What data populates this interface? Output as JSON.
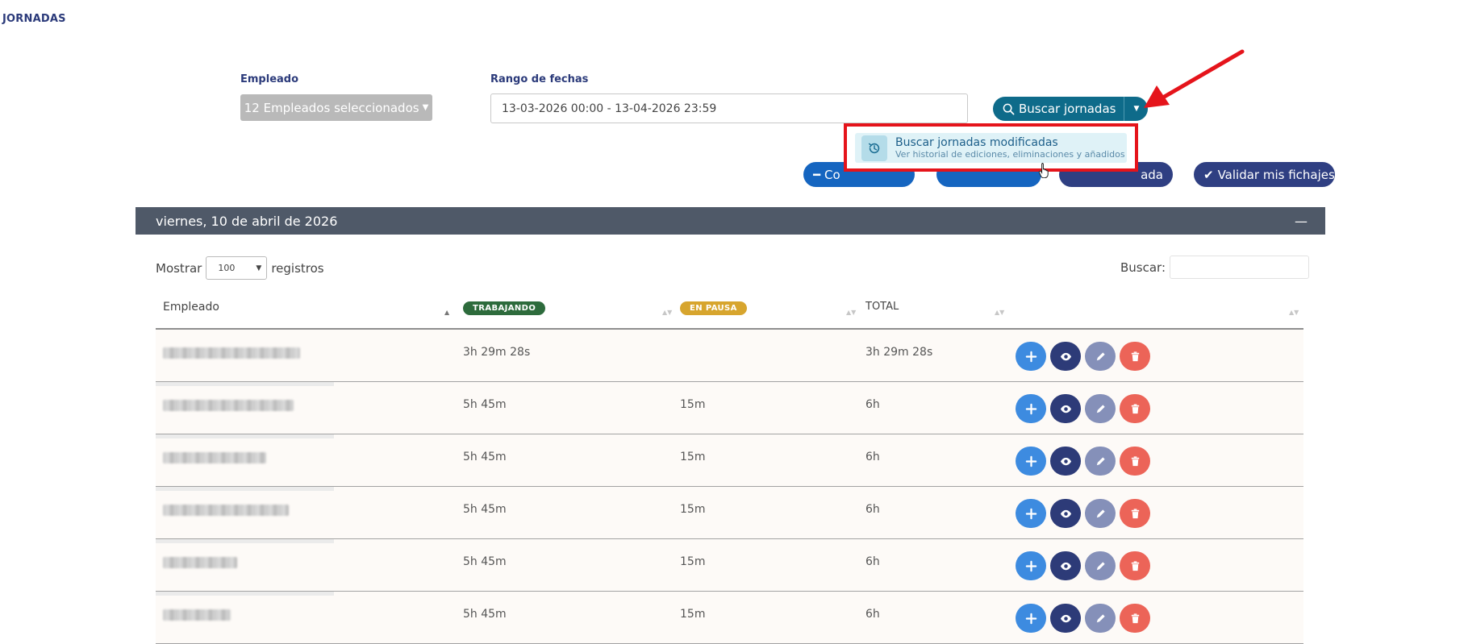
{
  "page": {
    "title": "JORNADAS"
  },
  "filters": {
    "employee_label": "Empleado",
    "employee_value": "12 Empleados seleccionados",
    "date_label": "Rango de fechas",
    "date_value": "13-03-2026 00:00 - 13-04-2026 23:59"
  },
  "search_button": {
    "label": "Buscar jornadas"
  },
  "dropdown": {
    "item_title": "Buscar jornadas modificadas",
    "item_subtitle": "Ver historial de ediciones, eliminaciones y añadidos"
  },
  "actions": {
    "pill1": "Co",
    "pill2": "",
    "pill3": "ada",
    "validate": "Validar mis fichajes"
  },
  "day_section": {
    "title": "viernes, 10 de abril de 2026",
    "collapse": "—"
  },
  "table_controls": {
    "show_label": "Mostrar",
    "show_value": "100",
    "records_label": "registros",
    "search_label": "Buscar:"
  },
  "table": {
    "headers": {
      "employee": "Empleado",
      "working": "TRABAJANDO",
      "paused": "EN PAUSA",
      "total": "TOTAL"
    },
    "rows": [
      {
        "working": "3h 29m 28s",
        "paused": "",
        "total": "3h 29m 28s"
      },
      {
        "working": "5h 45m",
        "paused": "15m",
        "total": "6h"
      },
      {
        "working": "5h 45m",
        "paused": "15m",
        "total": "6h"
      },
      {
        "working": "5h 45m",
        "paused": "15m",
        "total": "6h"
      },
      {
        "working": "5h 45m",
        "paused": "15m",
        "total": "6h"
      },
      {
        "working": "5h 45m",
        "paused": "15m",
        "total": "6h"
      }
    ]
  },
  "colors": {
    "primary_navy": "#2f3f82",
    "teal_button": "#0e6b8a",
    "date_header": "#4f5968",
    "highlight_red": "#e5141b",
    "add_button": "#3d8be0",
    "delete_button": "#ec6458"
  },
  "icons": [
    "search-icon",
    "caret-down-icon",
    "history-icon",
    "minus-icon",
    "check-icon",
    "plus-icon",
    "eye-icon",
    "pencil-icon",
    "trash-icon",
    "hand-cursor-icon",
    "red-arrow-annotation"
  ]
}
